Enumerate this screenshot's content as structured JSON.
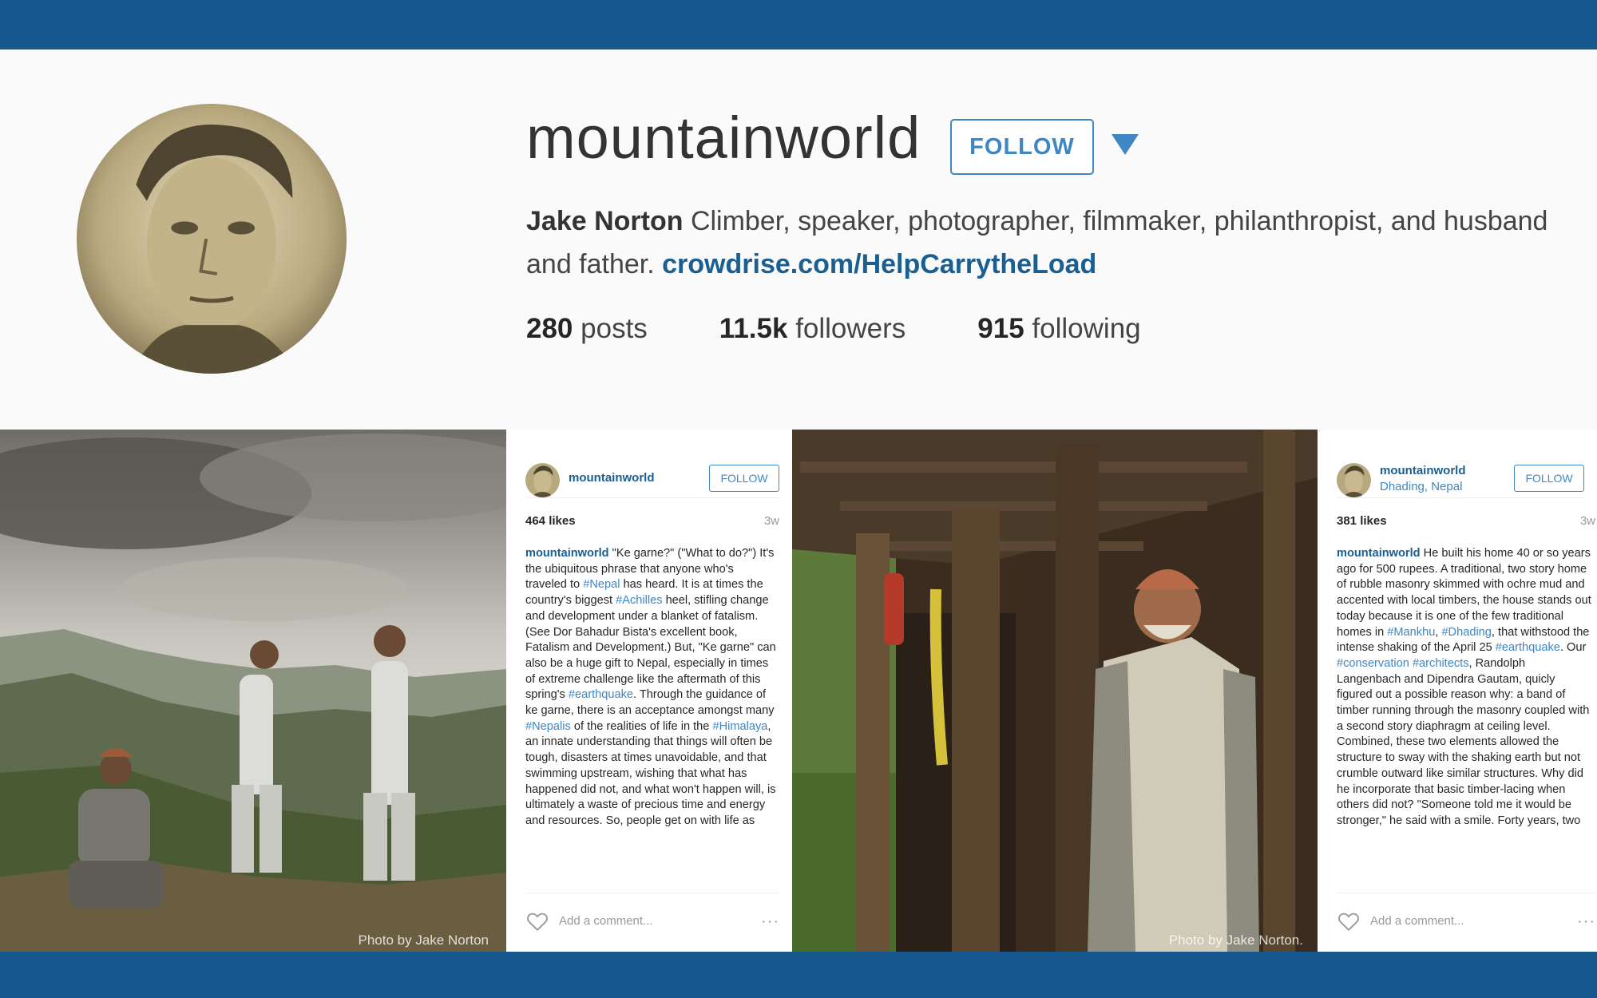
{
  "profile": {
    "username": "mountainworld",
    "follow_label": "FOLLOW",
    "bio_name": "Jake Norton",
    "bio_text": " Climber, speaker, photographer, filmmaker, philanthropist, and husband and father. ",
    "bio_link": "crowdrise.com/HelpCarrytheLoad",
    "stats": {
      "posts_count": "280",
      "posts_label": "posts",
      "followers_count": "11.5k",
      "followers_label": "followers",
      "following_count": "915",
      "following_label": "following"
    }
  },
  "posts": [
    {
      "username": "mountainworld",
      "location": "",
      "follow_label": "FOLLOW",
      "likes": "464 likes",
      "ago": "3w",
      "photo_credit": "Photo by Jake Norton",
      "caption_user": "mountainworld",
      "caption_parts": [
        {
          "text": " \"Ke garne?\" (\"What to do?\") It's the ubiquitous phrase that anyone who's traveled to "
        },
        {
          "text": "#Nepal",
          "tag": true
        },
        {
          "text": " has heard. It is at times the country's biggest "
        },
        {
          "text": "#Achilles",
          "tag": true
        },
        {
          "text": " heel, stifling change and development under a blanket of fatalism. (See Dor Bahadur Bista's excellent book, Fatalism and Development.) But, \"Ke garne\" can also be a huge gift to Nepal, especially in times of extreme challenge like the aftermath of this spring's "
        },
        {
          "text": "#earthquake",
          "tag": true
        },
        {
          "text": ". Through the guidance of ke garne, there is an acceptance amongst many "
        },
        {
          "text": "#Nepalis",
          "tag": true
        },
        {
          "text": " of the realities of life in the "
        },
        {
          "text": "#Himalaya",
          "tag": true
        },
        {
          "text": ", an innate understanding that things will often be tough, disasters at times unavoidable, and that swimming upstream, wishing that what has happened did not, and what won't happen will, is ultimately a waste of precious time and energy and resources. So, people get on with life as"
        }
      ],
      "comment_placeholder": "Add a comment...",
      "more_glyph": "···"
    },
    {
      "username": "mountainworld",
      "location": "Dhading, Nepal",
      "follow_label": "FOLLOW",
      "likes": "381 likes",
      "ago": "3w",
      "photo_credit": "Photo by Jake Norton.",
      "caption_user": "mountainworld",
      "caption_parts": [
        {
          "text": " He built his home 40 or so years ago for 500 rupees. A traditional, two story home of rubble masonry skimmed with ochre mud and accented with local timbers, the house stands out today because it is one of the few traditional homes in "
        },
        {
          "text": "#Mankhu",
          "tag": true
        },
        {
          "text": ", "
        },
        {
          "text": "#Dhading",
          "tag": true
        },
        {
          "text": ", that withstood the intense shaking of the April 25 "
        },
        {
          "text": "#earthquake",
          "tag": true
        },
        {
          "text": ". Our "
        },
        {
          "text": "#conservation",
          "tag": true
        },
        {
          "text": " "
        },
        {
          "text": "#architects",
          "tag": true
        },
        {
          "text": ", Randolph Langenbach and Dipendra Gautam, quicly figured out a possible reason why: a band of timber running through the masonry coupled with a second story diaphragm at ceiling level. Combined, these two elements allowed the structure to sway with the shaking earth but not crumble outward like similar structures. Why did he incorporate that basic timber-lacing when others did not? \"Someone told me it would be stronger,\" he said with a smile. Forty years, two"
        }
      ],
      "comment_placeholder": "Add a comment...",
      "more_glyph": "···"
    }
  ],
  "icons": {
    "follow_dropdown": "caret-down-icon",
    "like": "heart-outline-icon",
    "more": "more-options-icon"
  },
  "colors": {
    "band": "#17588f",
    "accent": "#3f86c5",
    "link": "#1b5e91"
  }
}
